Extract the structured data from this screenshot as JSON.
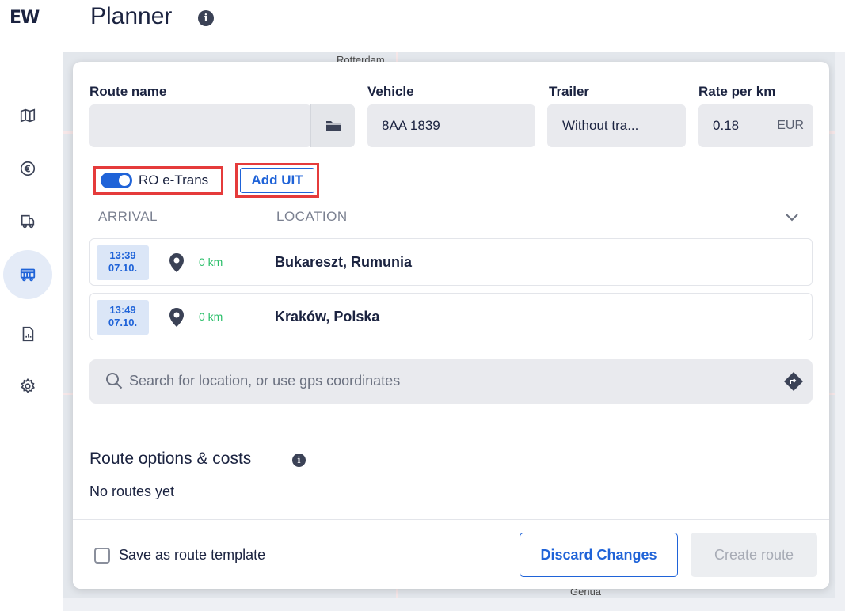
{
  "app": {
    "logo": "EW",
    "title": "Planner"
  },
  "sidebar": {
    "items": [
      {
        "name": "map",
        "icon": "map-icon"
      },
      {
        "name": "costs",
        "icon": "euro-icon"
      },
      {
        "name": "fleet",
        "icon": "truck-icon"
      },
      {
        "name": "planner",
        "icon": "bus-icon",
        "active": true
      },
      {
        "name": "reports",
        "icon": "report-icon"
      },
      {
        "name": "settings",
        "icon": "gear-icon"
      }
    ]
  },
  "map": {
    "labels": {
      "top": "Rotterdam",
      "bottom": "Genua"
    }
  },
  "form": {
    "route_name_label": "Route name",
    "route_name_value": "",
    "vehicle_label": "Vehicle",
    "vehicle_value": "8AA 1839",
    "trailer_label": "Trailer",
    "trailer_value": "Without tra...",
    "rate_label": "Rate per km",
    "rate_value": "0.18",
    "rate_currency": "EUR"
  },
  "etrans": {
    "label": "RO e-Trans",
    "enabled": true,
    "uit_button": "Add UIT"
  },
  "stops": {
    "headers": {
      "arrival": "ARRIVAL",
      "location": "LOCATION"
    },
    "rows": [
      {
        "time": "13:39",
        "date": "07.10.",
        "distance": "0 km",
        "location": "Bukareszt, Rumunia"
      },
      {
        "time": "13:49",
        "date": "07.10.",
        "distance": "0 km",
        "location": "Kraków, Polska"
      }
    ]
  },
  "search": {
    "placeholder": "Search for location, or use gps coordinates"
  },
  "route_options": {
    "title": "Route options & costs",
    "empty_text": "No routes yet"
  },
  "footer": {
    "save_template_label": "Save as route template",
    "discard_label": "Discard Changes",
    "create_label": "Create route"
  },
  "colors": {
    "accent": "#1f63d8",
    "highlight": "#e53b3b",
    "distance": "#2bbf6a"
  }
}
